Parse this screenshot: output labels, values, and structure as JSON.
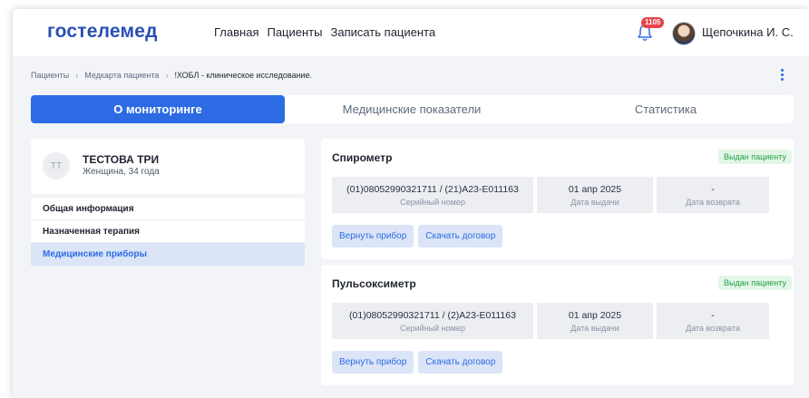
{
  "header": {
    "logo": "гостелемед",
    "nav": [
      "Главная",
      "Пациенты",
      "Записать пациента"
    ],
    "notifications_count": "1105",
    "user_name": "Щепочкина И. С."
  },
  "breadcrumb": [
    "Пациенты",
    "Медкарта пациента",
    "!ХОБЛ - клиническое исследование."
  ],
  "tabs": [
    "О мониторинге",
    "Медицинские показатели",
    "Статистика"
  ],
  "active_tab": "О мониторинге",
  "patient": {
    "initials": "ТТ",
    "name": "ТЕСТОВА ТРИ",
    "details": "Женщина, 34 года"
  },
  "menu": [
    "Общая информация",
    "Назначенная терапия",
    "Медицинские приборы"
  ],
  "active_menu": "Медицинские приборы",
  "devices": [
    {
      "title": "Спирометр",
      "status": "Выдан пациенту",
      "serial": "(01)08052990321711 / (21)A23-E011163",
      "serial_label": "Серийный номер",
      "issue_date": "01 апр 2025",
      "issue_label": "Дата выдачи",
      "return_date": "-",
      "return_label": "Дата возврата",
      "return_button": "Вернуть прибор",
      "contract_button": "Скачать договор"
    },
    {
      "title": "Пульсоксиметр",
      "status": "Выдан пациенту",
      "serial": "(01)08052990321711 / (2)A23-E011163",
      "serial_label": "Серийный номер",
      "issue_date": "01 апр 2025",
      "issue_label": "Дата выдачи",
      "return_date": "-",
      "return_label": "Дата возврата",
      "return_button": "Вернуть прибор",
      "contract_button": "Скачать договор"
    }
  ],
  "colors": {
    "brand": "#2a4fb4",
    "accent": "#2d6be4",
    "status_green": "#25a049",
    "badge_red": "#e8424b"
  }
}
